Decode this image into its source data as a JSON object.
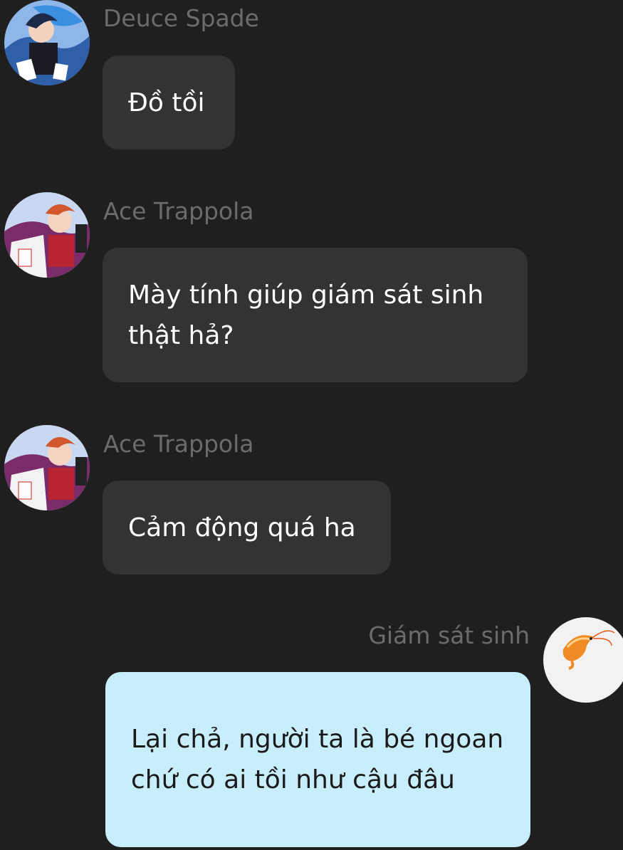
{
  "colors": {
    "background": "#1f1f1f",
    "incoming_bubble": "#333333",
    "outgoing_bubble": "#c8eefc",
    "sender_name": "#6b6b6b"
  },
  "messages": [
    {
      "sender": "Deuce Spade",
      "text": "Đồ tồi",
      "direction": "incoming",
      "avatar": "deuce-spade-avatar"
    },
    {
      "sender": "Ace Trappola",
      "text": "Mày tính giúp giám sát sinh thật hả?",
      "direction": "incoming",
      "avatar": "ace-trappola-avatar"
    },
    {
      "sender": "Ace Trappola",
      "text": "Cảm động quá ha",
      "direction": "incoming",
      "avatar": "ace-trappola-avatar"
    },
    {
      "sender": "Giám sát sinh",
      "text": "Lại chả, người ta là bé ngoan chứ có ai tồi như cậu đâu",
      "direction": "outgoing",
      "avatar": "shrimp-avatar"
    }
  ]
}
